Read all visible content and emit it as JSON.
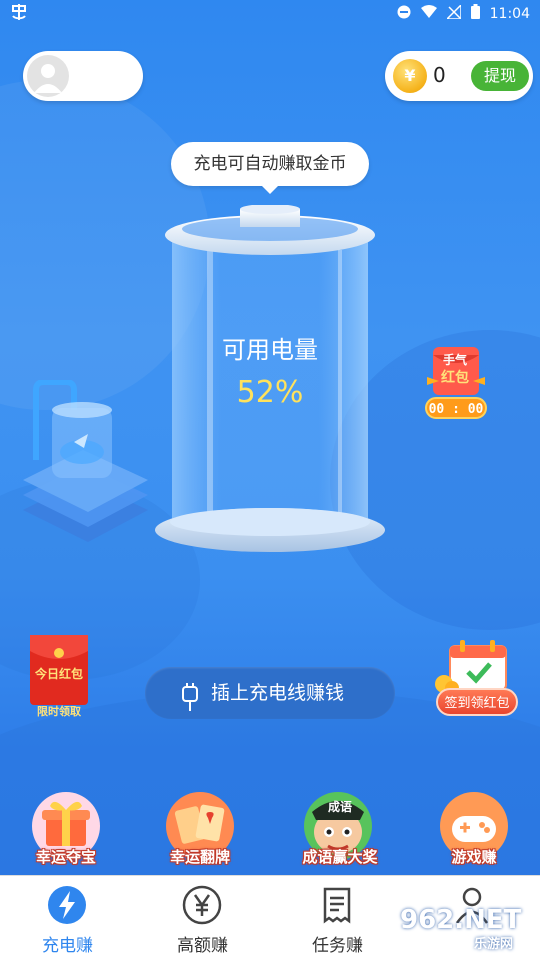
{
  "status_bar": {
    "left_icon": "shield-app-icon",
    "time": "11:04"
  },
  "header": {
    "coins": "0",
    "withdraw_label": "提现"
  },
  "tooltip": "充电可自动赚取金币",
  "battery": {
    "label": "可用电量",
    "percent": "52%"
  },
  "lucky_redpack": {
    "line1": "手气",
    "line2": "红包",
    "timer": "00 : 00"
  },
  "daily_redpack": {
    "label": "今日红包",
    "sub": "限时领取"
  },
  "signin": {
    "label": "签到领红包"
  },
  "plug_button": {
    "label": "插上充电线赚钱"
  },
  "games": [
    {
      "label": "幸运夺宝"
    },
    {
      "label": "幸运翻牌"
    },
    {
      "label": "成语赢大奖",
      "badge": "成语"
    },
    {
      "label": "游戏赚"
    }
  ],
  "nav": [
    {
      "label": "充电赚",
      "icon": "lightning-icon",
      "active": true
    },
    {
      "label": "高额赚",
      "icon": "yen-icon"
    },
    {
      "label": "任务赚",
      "icon": "receipt-icon"
    },
    {
      "label": "",
      "icon": "person-icon"
    }
  ],
  "watermark": {
    "text": "962.NET",
    "sub": "乐游网"
  },
  "colors": {
    "background": "#2f86ee",
    "accent": "#2f86ee",
    "withdraw": "#48b437",
    "battery_value": "#ffe25c"
  }
}
